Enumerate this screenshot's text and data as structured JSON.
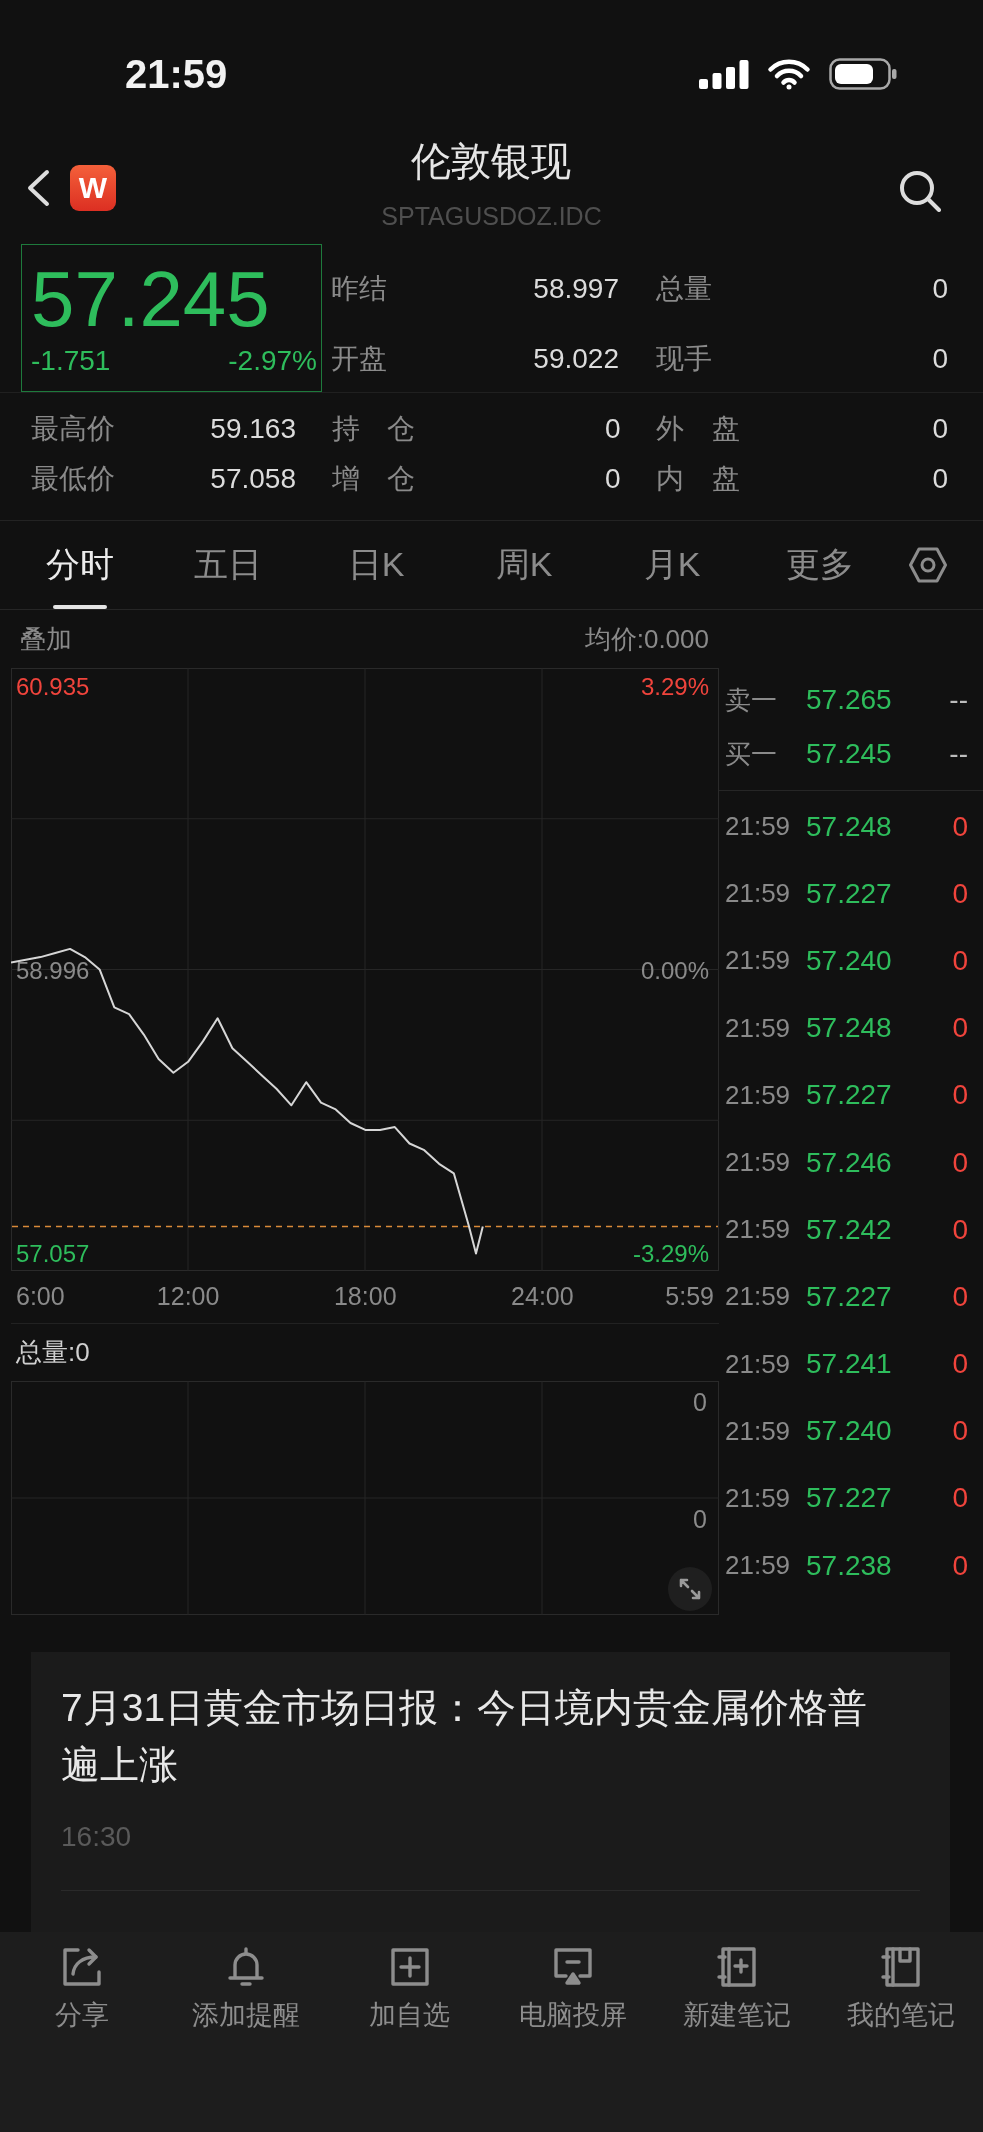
{
  "status_bar": {
    "time": "21:59"
  },
  "header": {
    "title": "伦敦银现",
    "code": "SPTAGUSDOZ.IDC",
    "logo_letter": "W"
  },
  "quote": {
    "price": "57.245",
    "change": "-1.751",
    "change_pct": "-2.97%",
    "rising": false,
    "stats": [
      {
        "label": "昨结",
        "value": "58.997"
      },
      {
        "label": "总量",
        "value": "0"
      },
      {
        "label": "开盘",
        "value": "59.022"
      },
      {
        "label": "现手",
        "value": "0"
      }
    ],
    "details": [
      {
        "label": "最高价",
        "value": "59.163"
      },
      {
        "label": "持 仓",
        "value": "0"
      },
      {
        "label": "外 盘",
        "value": "0"
      },
      {
        "label": "最低价",
        "value": "57.058"
      },
      {
        "label": "增 仓",
        "value": "0"
      },
      {
        "label": "内 盘",
        "value": "0"
      }
    ]
  },
  "tabs": [
    {
      "label": "分时",
      "selected": true
    },
    {
      "label": "五日",
      "selected": false
    },
    {
      "label": "日K",
      "selected": false
    },
    {
      "label": "周K",
      "selected": false
    },
    {
      "label": "月K",
      "selected": false
    },
    {
      "label": "更多",
      "selected": false
    }
  ],
  "chart": {
    "overlay_label": "叠加",
    "average": "均价:0.000",
    "percent_labels": [
      "3.29%",
      "0.00%",
      "-3.29%"
    ],
    "session_end": "5:59",
    "chart_data": {
      "type": "line",
      "x": [
        6,
        6.5,
        7,
        7.5,
        8,
        8.5,
        9,
        9.5,
        10,
        10.5,
        11,
        11.5,
        12,
        12.5,
        13,
        13.5,
        14,
        14.5,
        15,
        15.5,
        16,
        16.5,
        17,
        17.5,
        18,
        18.5,
        19,
        19.5,
        20,
        20.5,
        21,
        21.5,
        21.75,
        21.983
      ],
      "series": [
        {
          "values": [
            59.051,
            59.069,
            59.088,
            59.116,
            59.144,
            59.088,
            59.004,
            58.744,
            58.697,
            58.558,
            58.39,
            58.297,
            58.372,
            58.511,
            58.669,
            58.465,
            58.372,
            58.279,
            58.186,
            58.074,
            58.232,
            58.092,
            58.046,
            57.953,
            57.906,
            57.906,
            57.925,
            57.813,
            57.767,
            57.674,
            57.609,
            57.255,
            57.06,
            57.245
          ]
        }
      ],
      "xlim": [
        6,
        29.983
      ],
      "ylim": [
        56.941,
        61.065
      ],
      "xticks": [
        {
          "value": 6,
          "label": "6:00"
        },
        {
          "value": 12,
          "label": "12:00"
        },
        {
          "value": 18,
          "label": "18:00"
        },
        {
          "value": 24,
          "label": "24:00"
        }
      ],
      "yticks": [
        {
          "value": 60.935,
          "label": "60.935"
        },
        {
          "value": 58.996,
          "label": "58.996"
        },
        {
          "value": 57.057,
          "label": "57.057"
        }
      ],
      "ref_lines": [
        {
          "axis": "y",
          "value": 57.245
        }
      ],
      "grid": true
    }
  },
  "volume": {
    "title": "总量:0",
    "axis_labels": [
      "0",
      "0"
    ]
  },
  "order_book": {
    "quotes": [
      {
        "label": "卖一",
        "price": "57.265",
        "volume": "--"
      },
      {
        "label": "买一",
        "price": "57.245",
        "volume": "--"
      }
    ],
    "trades": [
      {
        "time": "21:59",
        "price": "57.248",
        "volume": "0"
      },
      {
        "time": "21:59",
        "price": "57.227",
        "volume": "0"
      },
      {
        "time": "21:59",
        "price": "57.240",
        "volume": "0"
      },
      {
        "time": "21:59",
        "price": "57.248",
        "volume": "0"
      },
      {
        "time": "21:59",
        "price": "57.227",
        "volume": "0"
      },
      {
        "time": "21:59",
        "price": "57.246",
        "volume": "0"
      },
      {
        "time": "21:59",
        "price": "57.242",
        "volume": "0"
      },
      {
        "time": "21:59",
        "price": "57.227",
        "volume": "0"
      },
      {
        "time": "21:59",
        "price": "57.241",
        "volume": "0"
      },
      {
        "time": "21:59",
        "price": "57.240",
        "volume": "0"
      },
      {
        "time": "21:59",
        "price": "57.227",
        "volume": "0"
      },
      {
        "time": "21:59",
        "price": "57.238",
        "volume": "0"
      }
    ]
  },
  "news": [
    {
      "title": "7月31日黄金市场日报：今日境内贵金属价格普遍上涨",
      "time": "16:30"
    }
  ],
  "toolbar": [
    {
      "label": "分享"
    },
    {
      "label": "添加提醒"
    },
    {
      "label": "加自选"
    },
    {
      "label": "电脑投屏"
    },
    {
      "label": "新建笔记"
    },
    {
      "label": "我的笔记"
    }
  ]
}
